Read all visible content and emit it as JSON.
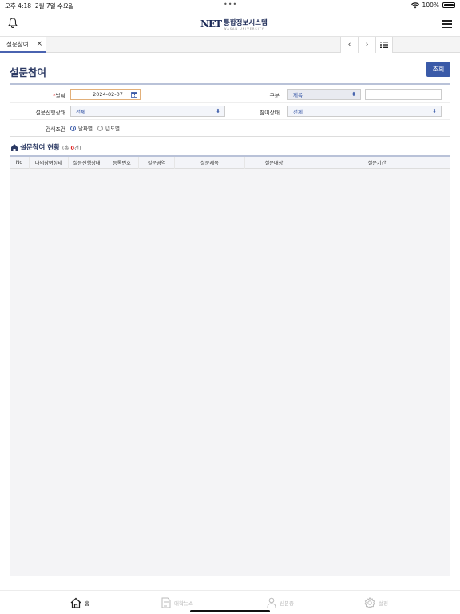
{
  "status": {
    "time": "오후 4:18",
    "date": "2월 7일 수요일",
    "battery": "100%"
  },
  "header": {
    "logo_mark": "NET",
    "logo_name": "통합정보시스템",
    "logo_sub": "WASAN UNIVERSITY"
  },
  "tabs": [
    {
      "label": "설문참여",
      "close": "×"
    }
  ],
  "tabnav": {
    "prev": "‹",
    "next": "›"
  },
  "page": {
    "title": "설문참여",
    "query_button": "조회"
  },
  "form": {
    "date_label": "날짜",
    "date_required": "*",
    "date_value": "2024-02-07",
    "type_label": "구분",
    "type_value": "제목",
    "type_text": "",
    "progress_label": "설문진행상태",
    "progress_value": "전체",
    "participation_label": "참여상태",
    "participation_value": "전체",
    "search_label": "검색조건",
    "radio_date": "날짜별",
    "radio_year": "년도별",
    "radio_selected": "날짜별"
  },
  "section": {
    "title": "설문참여 현황",
    "count_prefix": "(총 ",
    "count": "0",
    "count_suffix": "건)"
  },
  "table": {
    "columns": [
      "No",
      "나의참여상태",
      "설문진행상태",
      "등록번호",
      "설문영역",
      "설문제목",
      "설문대상",
      "설문기간"
    ],
    "rows": []
  },
  "bottomnav": [
    {
      "label": "홈",
      "icon": "home-icon",
      "active": true
    },
    {
      "label": "대학뉴스",
      "icon": "document-icon",
      "active": false
    },
    {
      "label": "신분증",
      "icon": "person-icon",
      "active": false
    },
    {
      "label": "설정",
      "icon": "gear-icon",
      "active": false
    }
  ],
  "colors": {
    "accent": "#3a5aa8",
    "title": "#2c3a64",
    "required": "#dd2222"
  }
}
